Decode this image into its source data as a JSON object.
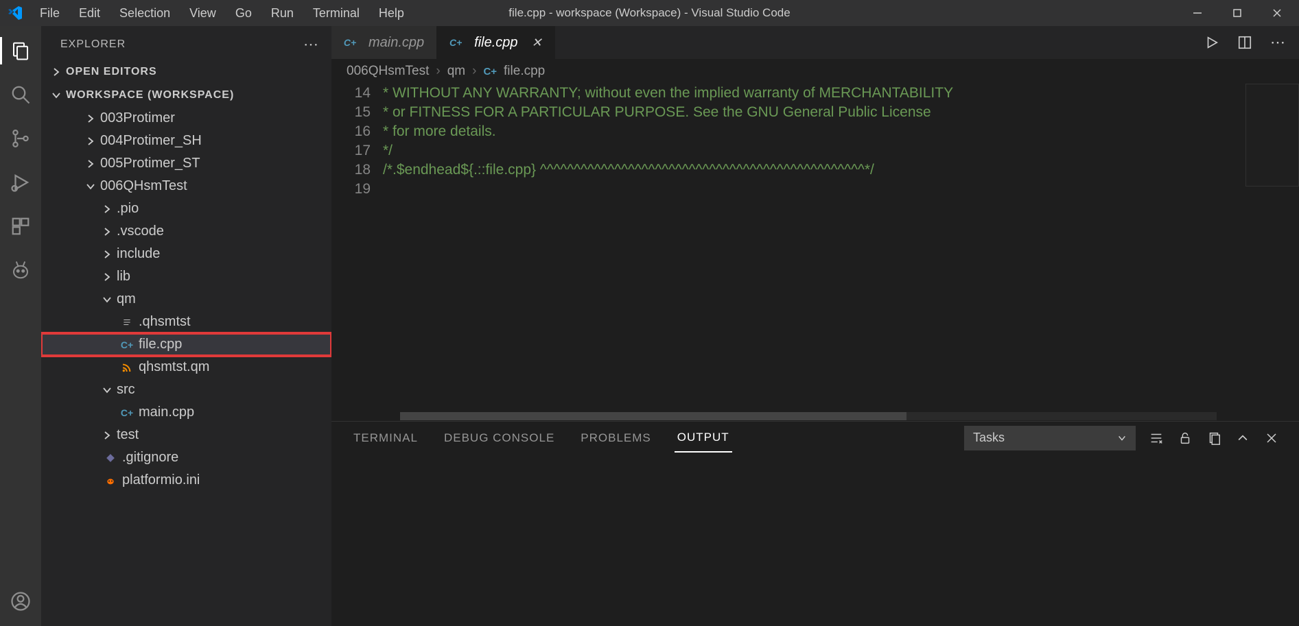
{
  "title": "file.cpp - workspace (Workspace) - Visual Studio Code",
  "menu": [
    "File",
    "Edit",
    "Selection",
    "View",
    "Go",
    "Run",
    "Terminal",
    "Help"
  ],
  "explorer": {
    "title": "EXPLORER",
    "openEditors": "OPEN EDITORS",
    "workspace": "WORKSPACE (WORKSPACE)"
  },
  "tree": {
    "folders": [
      {
        "name": "003Protimer",
        "depth": 1,
        "expanded": false
      },
      {
        "name": "004Protimer_SH",
        "depth": 1,
        "expanded": false
      },
      {
        "name": "005Protimer_ST",
        "depth": 1,
        "expanded": false
      },
      {
        "name": "006QHsmTest",
        "depth": 1,
        "expanded": true
      }
    ],
    "children": [
      {
        "type": "folder",
        "name": ".pio",
        "depth": 2,
        "expanded": false
      },
      {
        "type": "folder",
        "name": ".vscode",
        "depth": 2,
        "expanded": false
      },
      {
        "type": "folder",
        "name": "include",
        "depth": 2,
        "expanded": false
      },
      {
        "type": "folder",
        "name": "lib",
        "depth": 2,
        "expanded": false
      },
      {
        "type": "folder",
        "name": "qm",
        "depth": 2,
        "expanded": true
      },
      {
        "type": "file",
        "name": ".qhsmtst",
        "depth": 3,
        "icon": "text",
        "selected": false,
        "highlighted": false
      },
      {
        "type": "file",
        "name": "file.cpp",
        "depth": 3,
        "icon": "cpp",
        "selected": true,
        "highlighted": true
      },
      {
        "type": "file",
        "name": "qhsmtst.qm",
        "depth": 3,
        "icon": "rss",
        "selected": false,
        "highlighted": false
      },
      {
        "type": "folder",
        "name": "src",
        "depth": 2,
        "expanded": true
      },
      {
        "type": "file",
        "name": "main.cpp",
        "depth": 3,
        "icon": "cpp",
        "selected": false,
        "highlighted": false
      },
      {
        "type": "folder",
        "name": "test",
        "depth": 2,
        "expanded": false
      },
      {
        "type": "file",
        "name": ".gitignore",
        "depth": 2,
        "icon": "git",
        "selected": false,
        "highlighted": false
      },
      {
        "type": "file",
        "name": "platformio.ini",
        "depth": 2,
        "icon": "pio",
        "selected": false,
        "highlighted": false
      }
    ]
  },
  "tabs": [
    {
      "label": "main.cpp",
      "active": false,
      "icon": "cpp"
    },
    {
      "label": "file.cpp",
      "active": true,
      "icon": "cpp"
    }
  ],
  "breadcrumb": [
    "006QHsmTest",
    "qm",
    "file.cpp"
  ],
  "code": {
    "start": 14,
    "lines": [
      "* WITHOUT ANY WARRANTY; without even the implied warranty of MERCHANTABILITY",
      "* or FITNESS FOR A PARTICULAR PURPOSE. See the GNU General Public License",
      "* for more details.",
      "*/",
      "/*.$endhead${.::file.cpp} ^^^^^^^^^^^^^^^^^^^^^^^^^^^^^^^^^^^^^^^^^^^^^^^^*/",
      ""
    ]
  },
  "panel": {
    "tabs": [
      "TERMINAL",
      "DEBUG CONSOLE",
      "PROBLEMS",
      "OUTPUT"
    ],
    "active": "OUTPUT",
    "select": "Tasks"
  }
}
